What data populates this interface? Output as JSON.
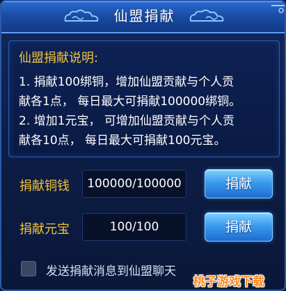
{
  "dialog": {
    "title": "仙盟捐献"
  },
  "description": {
    "heading": "仙盟捐献说明:",
    "lines": [
      "1. 捐献100绑铜，增加仙盟贡献与个人贡",
      "献各1点，  每日最大可捐献100000绑铜。",
      "2. 增加1元宝，  可增加仙盟贡献与个人贡",
      "献各10点，  每日最大可捐献100元宝。"
    ]
  },
  "donate_copper": {
    "label": "捐献铜钱",
    "value": "100000/100000",
    "button": "捐献"
  },
  "donate_ingot": {
    "label": "捐献元宝",
    "value": "100/100",
    "button": "捐献"
  },
  "broadcast": {
    "label": "发送捐献消息到仙盟聊天",
    "checked": false
  },
  "watermark": "桃子游戏下载",
  "colors": {
    "accent_gold": "#f2c33a",
    "button_blue": "#3b9bee",
    "title_bar": "#1a4aa3"
  },
  "icons": [
    "cloud-ornament-icon",
    "corner-ornament-icon"
  ]
}
